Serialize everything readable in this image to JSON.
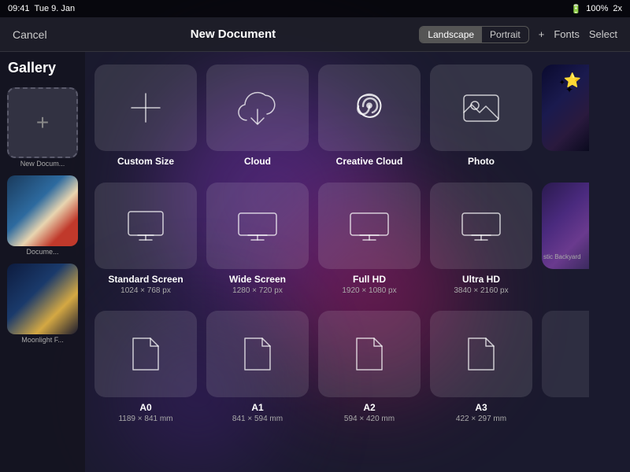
{
  "statusBar": {
    "time": "09:41",
    "day": "Tue 9. Jan",
    "battery": "100%",
    "batteryLabel": "2x"
  },
  "topBar": {
    "cancelLabel": "Cancel",
    "title": "New Document",
    "orientLandscape": "Landscape",
    "orientPortrait": "Portrait",
    "addLabel": "+",
    "fontsLabel": "Fonts",
    "selectLabel": "Select"
  },
  "sidebar": {
    "galleryLabel": "Gallery",
    "items": [
      {
        "label": "New Docum...",
        "type": "new"
      },
      {
        "label": "Docume...",
        "type": "winter"
      },
      {
        "label": "Moonlight F...",
        "type": "moonlight"
      }
    ]
  },
  "rows": [
    {
      "id": "row1",
      "cards": [
        {
          "id": "custom-size",
          "name": "Custom Size",
          "size": "",
          "icon": "plus"
        },
        {
          "id": "cloud",
          "name": "Cloud",
          "size": "",
          "icon": "cloud"
        },
        {
          "id": "creative-cloud",
          "name": "Creative Cloud",
          "size": "",
          "icon": "creative-cloud"
        },
        {
          "id": "photo",
          "name": "Photo",
          "size": "",
          "icon": "photo"
        },
        {
          "id": "partial-1",
          "name": "",
          "size": "",
          "icon": "partial",
          "partial": true
        }
      ]
    },
    {
      "id": "row2",
      "cards": [
        {
          "id": "standard-screen",
          "name": "Standard Screen",
          "size": "1024 × 768 px",
          "icon": "monitor"
        },
        {
          "id": "wide-screen",
          "name": "Wide Screen",
          "size": "1280 × 720 px",
          "icon": "monitor"
        },
        {
          "id": "full-hd",
          "name": "Full HD",
          "size": "1920 × 1080 px",
          "icon": "monitor"
        },
        {
          "id": "ultra-hd",
          "name": "Ultra HD",
          "size": "3840 × 2160 px",
          "icon": "monitor"
        },
        {
          "id": "partial-2",
          "name": "stic Backyard",
          "size": "",
          "icon": "partial-img",
          "partial": true
        }
      ]
    },
    {
      "id": "row3",
      "cards": [
        {
          "id": "a0",
          "name": "A0",
          "size": "1189 × 841 mm",
          "icon": "document"
        },
        {
          "id": "a1",
          "name": "A1",
          "size": "841 × 594 mm",
          "icon": "document"
        },
        {
          "id": "a2",
          "name": "A2",
          "size": "594 × 420 mm",
          "icon": "document"
        },
        {
          "id": "a3",
          "name": "A3",
          "size": "422 × 297 mm",
          "icon": "document"
        },
        {
          "id": "partial-3",
          "name": "",
          "size": "",
          "icon": "partial",
          "partial": true
        }
      ]
    }
  ]
}
